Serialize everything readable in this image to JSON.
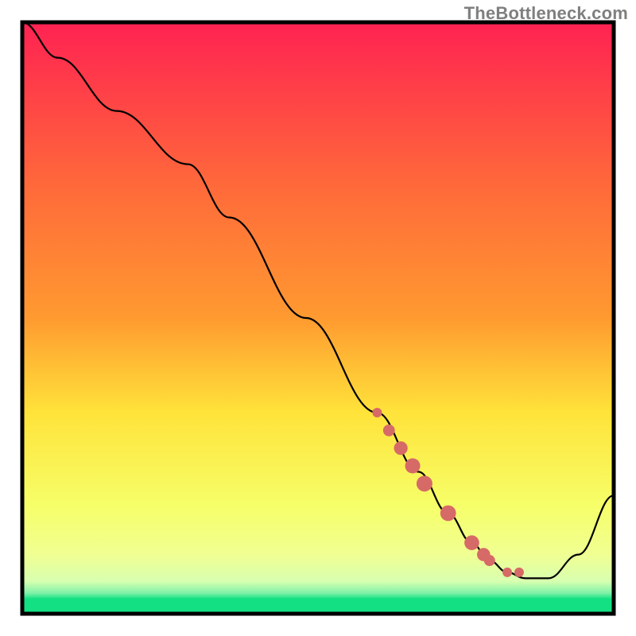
{
  "watermark": "TheBottleneck.com",
  "colors": {
    "frame": "#000000",
    "line": "#000000",
    "marker": "#d66a66",
    "gradient_top": "#ff2252",
    "gradient_mid1": "#ff9a30",
    "gradient_mid2": "#ffe33a",
    "gradient_mid3": "#f6ff6a",
    "gradient_bottom_band": "#d8ffb0",
    "gradient_green": "#12e082"
  },
  "chart_data": {
    "type": "line",
    "title": "",
    "xlabel": "",
    "ylabel": "",
    "xlim": [
      0,
      100
    ],
    "ylim": [
      0,
      100
    ],
    "grid": false,
    "legend": false,
    "series": [
      {
        "name": "curve",
        "x": [
          0,
          6,
          16,
          28,
          35,
          48,
          60,
          67,
          72,
          76,
          79,
          82,
          85,
          89,
          94,
          100
        ],
        "values": [
          100,
          94,
          85,
          76,
          67,
          50,
          34,
          24,
          17,
          12,
          9,
          7,
          6,
          6,
          10,
          20
        ]
      },
      {
        "name": "markers",
        "x": [
          60,
          62,
          64,
          66,
          68,
          72,
          76,
          78,
          79,
          82,
          84
        ],
        "values": [
          34,
          31,
          28,
          25,
          22,
          17,
          12,
          10,
          9,
          7,
          7
        ]
      }
    ]
  }
}
